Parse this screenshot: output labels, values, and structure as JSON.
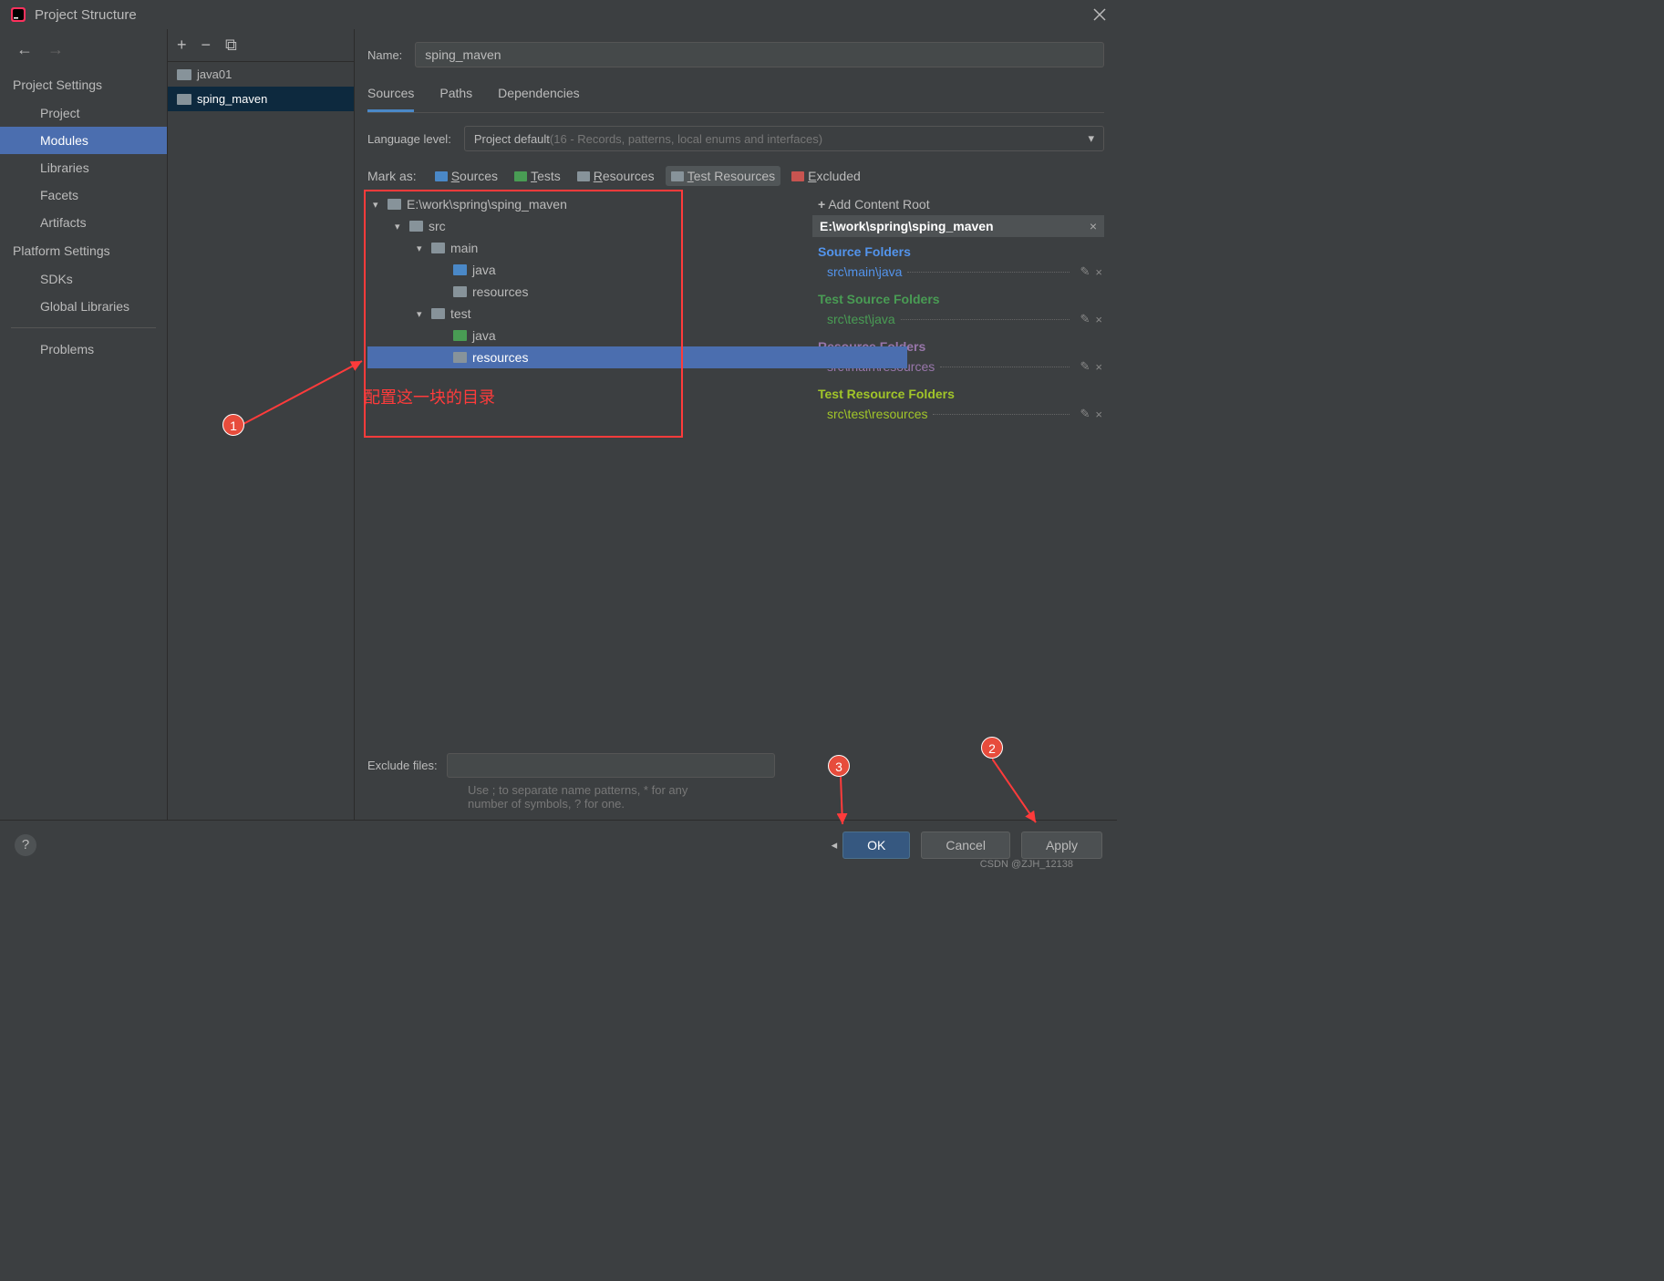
{
  "window": {
    "title": "Project Structure"
  },
  "sidebar": {
    "section1": "Project Settings",
    "section2": "Platform Settings",
    "items1": [
      "Project",
      "Modules",
      "Libraries",
      "Facets",
      "Artifacts"
    ],
    "items2": [
      "SDKs",
      "Global Libraries"
    ],
    "problems": "Problems",
    "selected": 1
  },
  "middle": {
    "modules": [
      "java01",
      "sping_maven"
    ],
    "selected": 1
  },
  "name": {
    "label": "Name:",
    "value": "sping_maven"
  },
  "tabs": {
    "items": [
      "Sources",
      "Paths",
      "Dependencies"
    ],
    "active": 0
  },
  "lang": {
    "label": "Language level:",
    "value": "Project default ",
    "hint": "(16 - Records, patterns, local enums and interfaces)"
  },
  "mark": {
    "label": "Mark as:",
    "items": [
      {
        "label": "Sources",
        "cls": "c-src"
      },
      {
        "label": "Tests",
        "cls": "c-test"
      },
      {
        "label": "Resources",
        "cls": "c-res"
      },
      {
        "label": "Test Resources",
        "cls": "c-tres"
      },
      {
        "label": "Excluded",
        "cls": "c-exc"
      }
    ],
    "selected": 3
  },
  "tree": {
    "rows": [
      {
        "indent": 0,
        "arrow": true,
        "folder": "#87939a",
        "label": "E:\\work\\spring\\sping_maven"
      },
      {
        "indent": 1,
        "arrow": true,
        "folder": "#87939a",
        "label": "src"
      },
      {
        "indent": 2,
        "arrow": true,
        "folder": "#87939a",
        "label": "main"
      },
      {
        "indent": 3,
        "arrow": false,
        "folder": "#4a88c7",
        "label": "java"
      },
      {
        "indent": 3,
        "arrow": false,
        "folder": "#87939a",
        "label": "resources"
      },
      {
        "indent": 2,
        "arrow": true,
        "folder": "#87939a",
        "label": "test"
      },
      {
        "indent": 3,
        "arrow": false,
        "folder": "#499c54",
        "label": "java"
      },
      {
        "indent": 3,
        "arrow": false,
        "folder": "#87939a",
        "label": "resources",
        "selected": true
      }
    ]
  },
  "annotation": {
    "text": "配置这一块的目录"
  },
  "right": {
    "add": "Add Content Root",
    "root": "E:\\work\\spring\\sping_maven",
    "sections": [
      {
        "head": "Source Folders",
        "cls": "t-src",
        "path": "src\\main\\java"
      },
      {
        "head": "Test Source Folders",
        "cls": "t-test",
        "path": "src\\test\\java"
      },
      {
        "head": "Resource Folders",
        "cls": "t-res",
        "path": "src\\main\\resources"
      },
      {
        "head": "Test Resource Folders",
        "cls": "t-tres",
        "path": "src\\test\\resources"
      }
    ]
  },
  "exclude": {
    "label": "Exclude files:",
    "hint1": "Use ; to separate name patterns, * for any",
    "hint2": "number of symbols, ? for one."
  },
  "footer": {
    "ok": "OK",
    "cancel": "Cancel",
    "apply": "Apply"
  },
  "badges": {
    "b1": "1",
    "b2": "2",
    "b3": "3"
  },
  "watermark": "CSDN @ZJH_12138"
}
